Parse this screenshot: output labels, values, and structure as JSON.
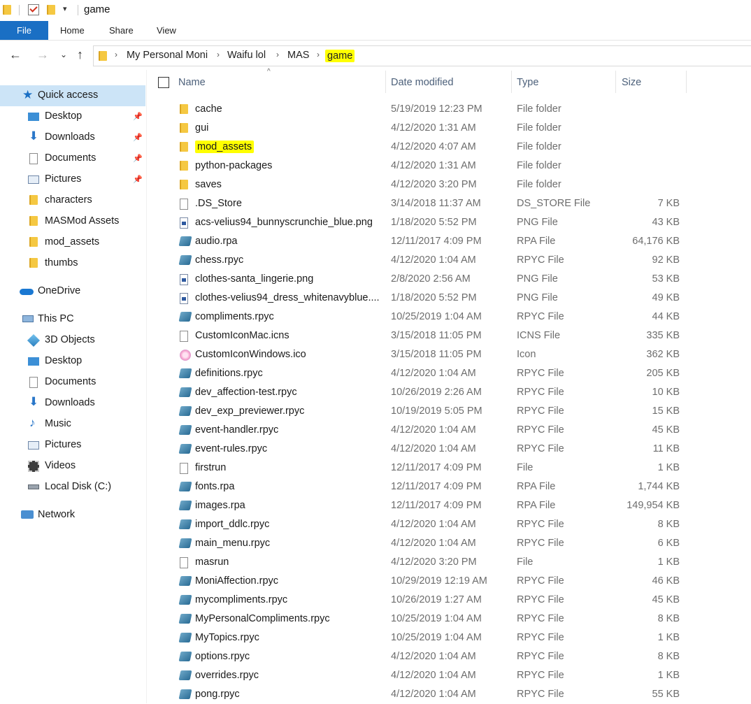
{
  "window": {
    "title": "game"
  },
  "ribbon": {
    "tabs": [
      "File",
      "Home",
      "Share",
      "View"
    ]
  },
  "address": {
    "crumbs": [
      "My Personal Moni",
      "Waifu lol",
      "MAS",
      "game"
    ]
  },
  "nav": {
    "quick_access": "Quick access",
    "quick_items": [
      "Desktop",
      "Downloads",
      "Documents",
      "Pictures",
      "characters",
      "MASMod Assets",
      "mod_assets",
      "thumbs"
    ],
    "onedrive": "OneDrive",
    "thispc": "This PC",
    "pc_items": [
      "3D Objects",
      "Desktop",
      "Documents",
      "Downloads",
      "Music",
      "Pictures",
      "Videos",
      "Local Disk (C:)"
    ],
    "network": "Network"
  },
  "columns": {
    "name": "Name",
    "date": "Date modified",
    "type": "Type",
    "size": "Size"
  },
  "files": [
    {
      "name": "cache",
      "date": "5/19/2019 12:23 PM",
      "type": "File folder",
      "size": "",
      "icon": "folder-icon"
    },
    {
      "name": "gui",
      "date": "4/12/2020 1:31 AM",
      "type": "File folder",
      "size": "",
      "icon": "folder-icon"
    },
    {
      "name": "mod_assets",
      "date": "4/12/2020 4:07 AM",
      "type": "File folder",
      "size": "",
      "icon": "folder-icon",
      "highlight": true
    },
    {
      "name": "python-packages",
      "date": "4/12/2020 1:31 AM",
      "type": "File folder",
      "size": "",
      "icon": "folder-icon"
    },
    {
      "name": "saves",
      "date": "4/12/2020 3:20 PM",
      "type": "File folder",
      "size": "",
      "icon": "folder-icon"
    },
    {
      "name": ".DS_Store",
      "date": "3/14/2018 11:37 AM",
      "type": "DS_STORE File",
      "size": "7 KB",
      "icon": "file-icon"
    },
    {
      "name": "acs-velius94_bunnyscrunchie_blue.png",
      "date": "1/18/2020 5:52 PM",
      "type": "PNG File",
      "size": "43 KB",
      "icon": "png-icon"
    },
    {
      "name": "audio.rpa",
      "date": "12/11/2017 4:09 PM",
      "type": "RPA File",
      "size": "64,176 KB",
      "icon": "rpa-icon"
    },
    {
      "name": "chess.rpyc",
      "date": "4/12/2020 1:04 AM",
      "type": "RPYC File",
      "size": "92 KB",
      "icon": "rpa-icon"
    },
    {
      "name": "clothes-santa_lingerie.png",
      "date": "2/8/2020 2:56 AM",
      "type": "PNG File",
      "size": "53 KB",
      "icon": "png-icon"
    },
    {
      "name": "clothes-velius94_dress_whitenavyblue....",
      "date": "1/18/2020 5:52 PM",
      "type": "PNG File",
      "size": "49 KB",
      "icon": "png-icon"
    },
    {
      "name": "compliments.rpyc",
      "date": "10/25/2019 1:04 AM",
      "type": "RPYC File",
      "size": "44 KB",
      "icon": "rpa-icon"
    },
    {
      "name": "CustomIconMac.icns",
      "date": "3/15/2018 11:05 PM",
      "type": "ICNS File",
      "size": "335 KB",
      "icon": "file-icon"
    },
    {
      "name": "CustomIconWindows.ico",
      "date": "3/15/2018 11:05 PM",
      "type": "Icon",
      "size": "362 KB",
      "icon": "ico-icon"
    },
    {
      "name": "definitions.rpyc",
      "date": "4/12/2020 1:04 AM",
      "type": "RPYC File",
      "size": "205 KB",
      "icon": "rpa-icon"
    },
    {
      "name": "dev_affection-test.rpyc",
      "date": "10/26/2019 2:26 AM",
      "type": "RPYC File",
      "size": "10 KB",
      "icon": "rpa-icon"
    },
    {
      "name": "dev_exp_previewer.rpyc",
      "date": "10/19/2019 5:05 PM",
      "type": "RPYC File",
      "size": "15 KB",
      "icon": "rpa-icon"
    },
    {
      "name": "event-handler.rpyc",
      "date": "4/12/2020 1:04 AM",
      "type": "RPYC File",
      "size": "45 KB",
      "icon": "rpa-icon"
    },
    {
      "name": "event-rules.rpyc",
      "date": "4/12/2020 1:04 AM",
      "type": "RPYC File",
      "size": "11 KB",
      "icon": "rpa-icon"
    },
    {
      "name": "firstrun",
      "date": "12/11/2017 4:09 PM",
      "type": "File",
      "size": "1 KB",
      "icon": "file-icon"
    },
    {
      "name": "fonts.rpa",
      "date": "12/11/2017 4:09 PM",
      "type": "RPA File",
      "size": "1,744 KB",
      "icon": "rpa-icon"
    },
    {
      "name": "images.rpa",
      "date": "12/11/2017 4:09 PM",
      "type": "RPA File",
      "size": "149,954 KB",
      "icon": "rpa-icon"
    },
    {
      "name": "import_ddlc.rpyc",
      "date": "4/12/2020 1:04 AM",
      "type": "RPYC File",
      "size": "8 KB",
      "icon": "rpa-icon"
    },
    {
      "name": "main_menu.rpyc",
      "date": "4/12/2020 1:04 AM",
      "type": "RPYC File",
      "size": "6 KB",
      "icon": "rpa-icon"
    },
    {
      "name": "masrun",
      "date": "4/12/2020 3:20 PM",
      "type": "File",
      "size": "1 KB",
      "icon": "file-icon"
    },
    {
      "name": "MoniAffection.rpyc",
      "date": "10/29/2019 12:19 AM",
      "type": "RPYC File",
      "size": "46 KB",
      "icon": "rpa-icon"
    },
    {
      "name": "mycompliments.rpyc",
      "date": "10/26/2019 1:27 AM",
      "type": "RPYC File",
      "size": "45 KB",
      "icon": "rpa-icon"
    },
    {
      "name": "MyPersonalCompliments.rpyc",
      "date": "10/25/2019 1:04 AM",
      "type": "RPYC File",
      "size": "8 KB",
      "icon": "rpa-icon"
    },
    {
      "name": "MyTopics.rpyc",
      "date": "10/25/2019 1:04 AM",
      "type": "RPYC File",
      "size": "1 KB",
      "icon": "rpa-icon"
    },
    {
      "name": "options.rpyc",
      "date": "4/12/2020 1:04 AM",
      "type": "RPYC File",
      "size": "8 KB",
      "icon": "rpa-icon"
    },
    {
      "name": "overrides.rpyc",
      "date": "4/12/2020 1:04 AM",
      "type": "RPYC File",
      "size": "1 KB",
      "icon": "rpa-icon"
    },
    {
      "name": "pong.rpyc",
      "date": "4/12/2020 1:04 AM",
      "type": "RPYC File",
      "size": "55 KB",
      "icon": "rpa-icon"
    }
  ],
  "colors": {
    "accent": "#1a6fc4",
    "selection": "#cce4f7",
    "highlight": "#ffff00",
    "folder": "#f5c842"
  }
}
